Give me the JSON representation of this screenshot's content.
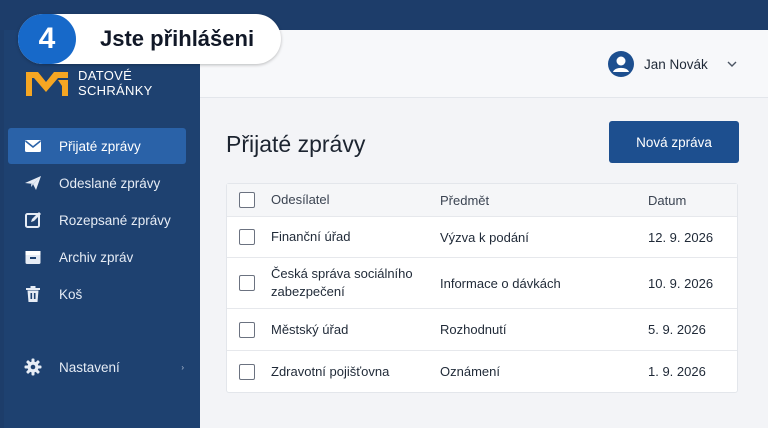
{
  "step": {
    "number": "4",
    "text": "Jste přihlášeni"
  },
  "logo": {
    "line1": "DATOVÉ",
    "line2": "SCHRÁNKY"
  },
  "sidebar": {
    "items": [
      {
        "label": "Přijaté zprávy",
        "icon": "envelope-icon",
        "active": true
      },
      {
        "label": "Odeslané zprávy",
        "icon": "paper-plane-icon",
        "active": false
      },
      {
        "label": "Rozepsané zprávy",
        "icon": "edit-icon",
        "active": false
      },
      {
        "label": "Archiv zpráv",
        "icon": "archive-icon",
        "active": false
      },
      {
        "label": "Koš",
        "icon": "trash-icon",
        "active": false
      }
    ],
    "settings": {
      "label": "Nastavení",
      "icon": "gear-icon"
    }
  },
  "user": {
    "name": "Jan Novák"
  },
  "main": {
    "title": "Přijaté zprávy",
    "new_button": "Nová zpráva"
  },
  "table": {
    "headers": {
      "sender": "Odesílatel",
      "subject": "Předmět",
      "date": "Datum"
    },
    "rows": [
      {
        "sender": "Finanční úřad",
        "subject": "Výzva k podání",
        "date": "12. 9. 2026"
      },
      {
        "sender": "Česká správa sociálního zabezpečení",
        "subject": "Informace o dávkách",
        "date": "10. 9. 2026"
      },
      {
        "sender": "Městský úřad",
        "subject": "Rozhodnutí",
        "date": "5. 9. 2026"
      },
      {
        "sender": "Zdravotní pojišťovna",
        "subject": "Oznámení",
        "date": "1. 9. 2026"
      }
    ]
  },
  "colors": {
    "sidebar_bg": "#1e4170",
    "active_item": "#2a62a8",
    "primary_button": "#1d4f8f",
    "step_badge": "#1769c9",
    "logo_accent": "#f5a623"
  }
}
